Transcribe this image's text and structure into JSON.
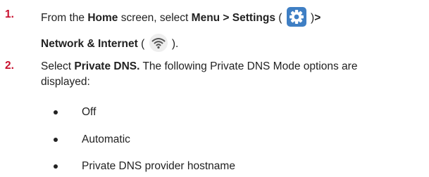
{
  "step1": {
    "number": "1.",
    "t1": "From the ",
    "home": "Home",
    "t2": " screen, select ",
    "menu_settings": "Menu > Settings",
    "t3": " ( ",
    "t4": " )",
    "gt": ">",
    "network": "Network & Internet",
    "t5": " ( ",
    "t6": " ).",
    "settings_icon": "gear-icon",
    "network_icon": "wifi-icon"
  },
  "step2": {
    "number": "2.",
    "t1": "Select ",
    "private_dns": "Private DNS.",
    "t2": " The following Private DNS Mode options are",
    "line2": "displayed:"
  },
  "options": [
    "Off",
    "Automatic",
    "Private DNS provider hostname"
  ],
  "colors": {
    "step_number": "#c8102e",
    "settings_icon_bg": "#3f7fc4",
    "wifi_icon_bg": "#eeeeee"
  }
}
